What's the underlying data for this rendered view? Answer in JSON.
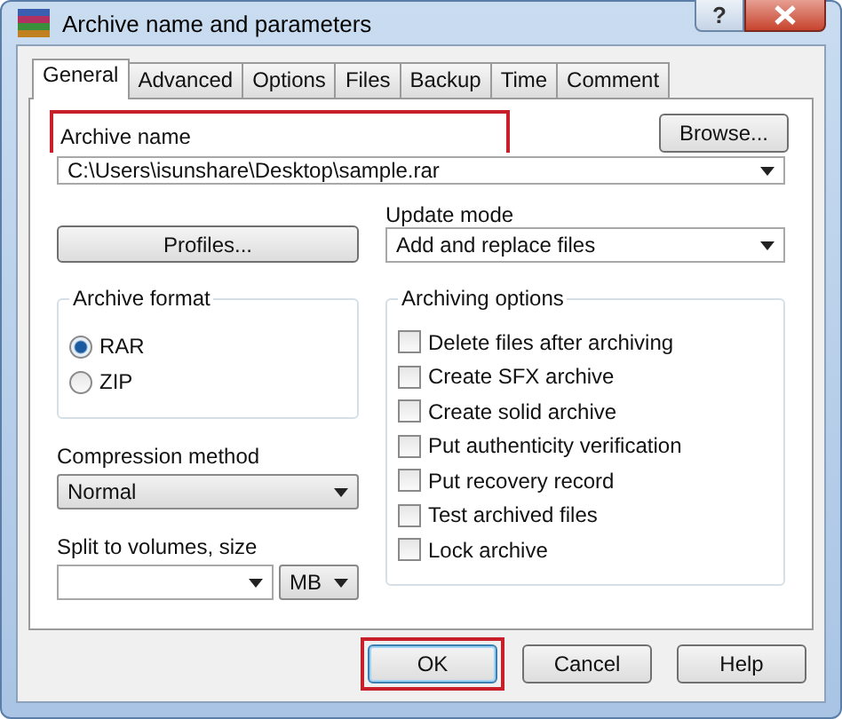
{
  "window": {
    "title": "Archive name and parameters",
    "help_glyph": "?"
  },
  "tabs": [
    {
      "label": "General",
      "selected": true
    },
    {
      "label": "Advanced",
      "selected": false
    },
    {
      "label": "Options",
      "selected": false
    },
    {
      "label": "Files",
      "selected": false
    },
    {
      "label": "Backup",
      "selected": false
    },
    {
      "label": "Time",
      "selected": false
    },
    {
      "label": "Comment",
      "selected": false
    }
  ],
  "archive_name": {
    "label": "Archive name",
    "value": "C:\\Users\\isunshare\\Desktop\\sample.rar",
    "highlighted": true
  },
  "browse_button": "Browse...",
  "profiles_button": "Profiles...",
  "update_mode": {
    "label": "Update mode",
    "value": "Add and replace files"
  },
  "archive_format": {
    "title": "Archive format",
    "options": [
      {
        "label": "RAR",
        "selected": true
      },
      {
        "label": "ZIP",
        "selected": false
      }
    ]
  },
  "compression_method": {
    "label": "Compression method",
    "value": "Normal"
  },
  "split": {
    "label": "Split to volumes, size",
    "unit": "MB"
  },
  "archiving_options": {
    "title": "Archiving options",
    "items": [
      {
        "label": "Delete files after archiving",
        "checked": false
      },
      {
        "label": "Create SFX archive",
        "checked": false
      },
      {
        "label": "Create solid archive",
        "checked": false
      },
      {
        "label": "Put authenticity verification",
        "checked": false
      },
      {
        "label": "Put recovery record",
        "checked": false
      },
      {
        "label": "Test archived files",
        "checked": false
      },
      {
        "label": "Lock archive",
        "checked": false
      }
    ]
  },
  "buttons": [
    {
      "label": "OK",
      "highlighted": true
    },
    {
      "label": "Cancel",
      "highlighted": false
    },
    {
      "label": "Help",
      "highlighted": false
    }
  ]
}
